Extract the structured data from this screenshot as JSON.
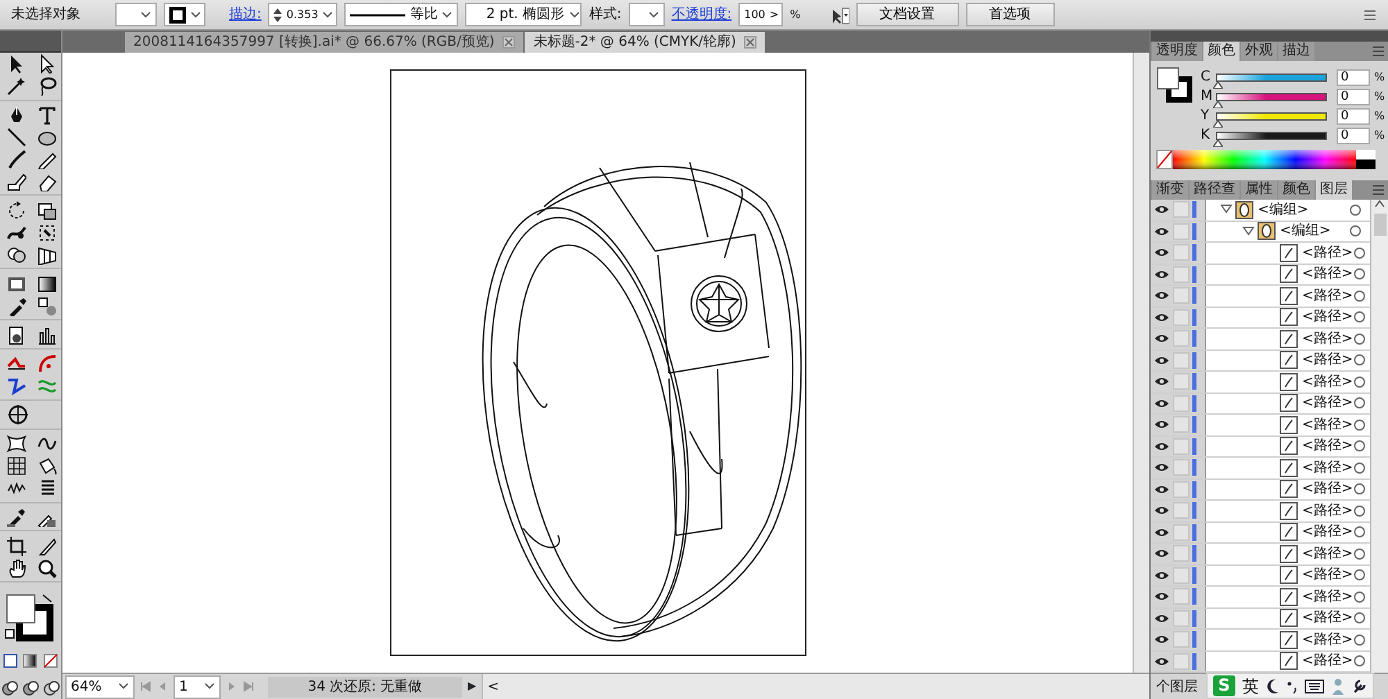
{
  "control_bar": {
    "selection_label": "未选择对象",
    "stroke_label": "描边:",
    "stroke_weight": "0.353",
    "stroke_profile": "等比",
    "brush": "2 pt. 椭圆形",
    "style_label": "样式:",
    "opacity_label": "不透明度:",
    "opacity": "100",
    "opacity_arrow": ">",
    "opacity_unit": "%",
    "buttons": [
      "文档设置",
      "首选项"
    ]
  },
  "document_tabs": [
    {
      "title": "2008114164357997 [转换].ai* @ 66.67% (RGB/预览)",
      "selected": false
    },
    {
      "title": "未标题-2* @ 64% (CMYK/轮廓)",
      "selected": true
    }
  ],
  "color_panel": {
    "tabs": [
      {
        "label": "透明度",
        "selected": false
      },
      {
        "label": "颜色",
        "selected": true
      },
      {
        "label": "外观",
        "selected": false
      },
      {
        "label": "描边",
        "selected": false
      }
    ],
    "channels": [
      {
        "name": "C",
        "value": "0",
        "unit": "%",
        "level": 0,
        "color": "#1aa3dc"
      },
      {
        "name": "M",
        "value": "0",
        "unit": "%",
        "level": 0,
        "color": "#d8127e"
      },
      {
        "name": "Y",
        "value": "0",
        "unit": "%",
        "level": 0,
        "color": "#f0e800"
      },
      {
        "name": "K",
        "value": "0",
        "unit": "%",
        "level": 0,
        "color": "#1a1a1a"
      }
    ]
  },
  "layers_panel": {
    "tabs": [
      {
        "label": "渐变",
        "selected": false
      },
      {
        "label": "路径查",
        "selected": false
      },
      {
        "label": "属性",
        "selected": false
      },
      {
        "label": "颜色",
        "selected": false
      },
      {
        "label": "图层",
        "selected": true
      }
    ],
    "layers": [
      {
        "name": "<编组>",
        "visible": true,
        "expanded": true,
        "children": [
          {
            "name": "<编组>",
            "visible": true,
            "expanded": true,
            "children": [
              {
                "name": "<路径>",
                "visible": true
              },
              {
                "name": "<路径>",
                "visible": true
              },
              {
                "name": "<路径>",
                "visible": true
              },
              {
                "name": "<路径>",
                "visible": true
              },
              {
                "name": "<路径>",
                "visible": true
              },
              {
                "name": "<路径>",
                "visible": true
              },
              {
                "name": "<路径>",
                "visible": true
              },
              {
                "name": "<路径>",
                "visible": true
              },
              {
                "name": "<路径>",
                "visible": true
              },
              {
                "name": "<路径>",
                "visible": true
              },
              {
                "name": "<路径>",
                "visible": true
              },
              {
                "name": "<路径>",
                "visible": true
              },
              {
                "name": "<路径>",
                "visible": true
              },
              {
                "name": "<路径>",
                "visible": true
              },
              {
                "name": "<路径>",
                "visible": true
              },
              {
                "name": "<路径>",
                "visible": true
              },
              {
                "name": "<路径>",
                "visible": true
              },
              {
                "name": "<路径>",
                "visible": true
              },
              {
                "name": "<路径>",
                "visible": true
              },
              {
                "name": "<路径>",
                "visible": true
              }
            ]
          }
        ]
      }
    ],
    "footer": "个图层"
  },
  "status_bar": {
    "zoom": "64%",
    "artboard": "1",
    "undo": "34 次还原: 无重做",
    "arrow": "▶",
    "scroll_left": "<"
  },
  "ime_bar": {
    "logo": "S",
    "mode": "英"
  }
}
